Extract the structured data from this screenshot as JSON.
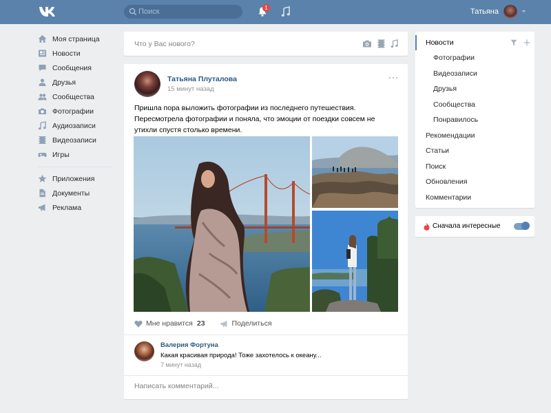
{
  "header": {
    "search_placeholder": "Поиск",
    "notifications_badge": "1",
    "user_name": "Татьяна"
  },
  "left_menu": {
    "items": [
      {
        "label": "Моя страница",
        "icon": "home-icon"
      },
      {
        "label": "Новости",
        "icon": "news-icon"
      },
      {
        "label": "Сообщения",
        "icon": "messages-icon"
      },
      {
        "label": "Друзья",
        "icon": "friends-icon"
      },
      {
        "label": "Сообщества",
        "icon": "communities-icon"
      },
      {
        "label": "Фотографии",
        "icon": "camera-icon"
      },
      {
        "label": "Аудиозаписи",
        "icon": "music-icon"
      },
      {
        "label": "Видеозаписи",
        "icon": "video-icon"
      },
      {
        "label": "Игры",
        "icon": "gamepad-icon"
      }
    ],
    "secondary_items": [
      {
        "label": "Приложения",
        "icon": "star-icon"
      },
      {
        "label": "Документы",
        "icon": "document-icon"
      },
      {
        "label": "Реклама",
        "icon": "megaphone-icon"
      }
    ]
  },
  "compose": {
    "placeholder": "Что у Вас нового?"
  },
  "post": {
    "author": "Татьяна Плуталова",
    "time": "15 минут назад",
    "text": "Пришла пора выложить фотографии из последнего путешествия. Пересмотрела фотографии и поняла, что эмоции от поездки совсем не утихли спустя столько времени.",
    "like_label": "Мне нравится",
    "like_count": "23",
    "share_label": "Поделиться"
  },
  "comment": {
    "author": "Валерия Фортуна",
    "text": "Какая красивая природа! Тоже захотелось к океану...",
    "time": "7 минут назад"
  },
  "reply": {
    "placeholder": "Написать комментарий..."
  },
  "right_menu": {
    "title": "Новости",
    "sub_items": [
      "Фотографии",
      "Видеозаписи",
      "Друзья",
      "Сообщества",
      "Понравилось"
    ],
    "items": [
      "Рекомендации",
      "Статьи",
      "Поиск",
      "Обновления",
      "Комментарии"
    ]
  },
  "interesting": {
    "label": "Сначала интересные",
    "enabled": true
  },
  "colors": {
    "header": "#5b82ab",
    "link": "#2a5885",
    "background": "#edeef0",
    "accent": "#5181b8"
  }
}
